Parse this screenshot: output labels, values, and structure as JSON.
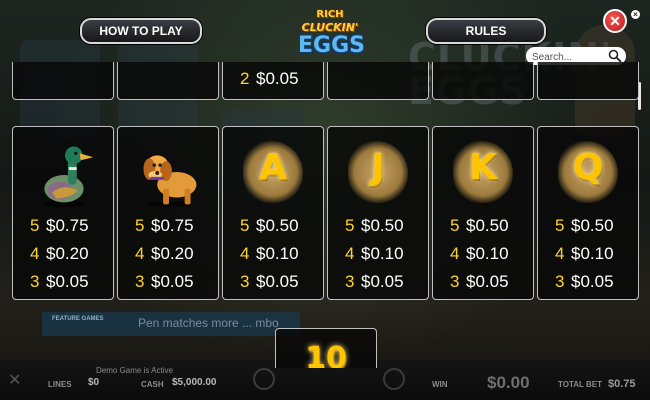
{
  "header": {
    "how_to_play_label": "HOW TO PLAY",
    "rules_label": "RULES",
    "logo": {
      "line1": "RICH",
      "line2": "CLUCKIN'",
      "line3": "EGGS"
    },
    "close_symbol": "✕",
    "small_close_symbol": "×",
    "search_placeholder": "Search..."
  },
  "background": {
    "logo_text": "CLUCKIN' EGGS",
    "banner_title": "FEATURE GAMES",
    "banner_text": "Pen matches more ... mbo",
    "bottom_bar": {
      "status": "Demo Game is Active",
      "lines_label": "LINES",
      "lines_value": "$0",
      "cash_label": "CASH",
      "cash_value": "$5,000.00",
      "win_label": "WIN",
      "win_value": "$0.00",
      "total_bet_label": "TOTAL BET",
      "total_bet_value": "$0.75"
    }
  },
  "paytable": {
    "top_partial": [
      {
        "count": "2",
        "value": "$0.05"
      }
    ],
    "symbols": [
      {
        "symbol": "duck",
        "rows": [
          {
            "count": "5",
            "value": "$0.75"
          },
          {
            "count": "4",
            "value": "$0.20"
          },
          {
            "count": "3",
            "value": "$0.05"
          }
        ]
      },
      {
        "symbol": "dog",
        "rows": [
          {
            "count": "5",
            "value": "$0.75"
          },
          {
            "count": "4",
            "value": "$0.20"
          },
          {
            "count": "3",
            "value": "$0.05"
          }
        ]
      },
      {
        "symbol": "A",
        "rows": [
          {
            "count": "5",
            "value": "$0.50"
          },
          {
            "count": "4",
            "value": "$0.10"
          },
          {
            "count": "3",
            "value": "$0.05"
          }
        ]
      },
      {
        "symbol": "J",
        "rows": [
          {
            "count": "5",
            "value": "$0.50"
          },
          {
            "count": "4",
            "value": "$0.10"
          },
          {
            "count": "3",
            "value": "$0.05"
          }
        ]
      },
      {
        "symbol": "K",
        "rows": [
          {
            "count": "5",
            "value": "$0.50"
          },
          {
            "count": "4",
            "value": "$0.10"
          },
          {
            "count": "3",
            "value": "$0.05"
          }
        ]
      },
      {
        "symbol": "Q",
        "rows": [
          {
            "count": "5",
            "value": "$0.50"
          },
          {
            "count": "4",
            "value": "$0.10"
          },
          {
            "count": "3",
            "value": "$0.05"
          }
        ]
      }
    ],
    "bonus_symbol": "10"
  },
  "colors": {
    "count_yellow": "#ffd428",
    "value_white": "#ffffff",
    "close_red": "#d0181e",
    "panel_border": "#e1e1e1"
  },
  "icons": {
    "search": "magnifier-icon",
    "close": "close-icon"
  }
}
